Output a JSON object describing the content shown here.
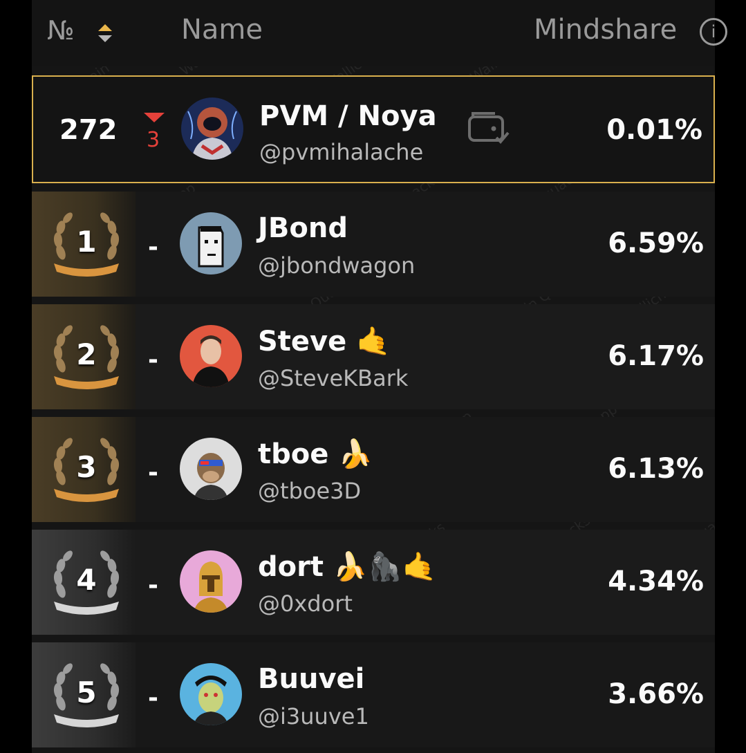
{
  "header": {
    "rank_label": "№",
    "name_label": "Name",
    "mindshare_label": "Mindshare",
    "info_glyph": "i",
    "sort_icon": "sort-updown-icon"
  },
  "watermark": [
    "Wallichain Quacks",
    "quacks.app"
  ],
  "self_row": {
    "rank": "272",
    "change": "3",
    "change_direction": "down",
    "name": "PVM / Noya",
    "handle": "@pvmihalache",
    "badge_icon": "wallet-verified-icon",
    "mindshare": "0.01%",
    "highlight_color": "#d9b04e"
  },
  "rows": [
    {
      "rank": "1",
      "change": "-",
      "name": "JBond",
      "handle": "@jbondwagon",
      "mindshare": "6.59%",
      "tier": "gold"
    },
    {
      "rank": "2",
      "change": "-",
      "name": "Steve 🤙",
      "handle": "@SteveKBark",
      "mindshare": "6.17%",
      "tier": "gold"
    },
    {
      "rank": "3",
      "change": "-",
      "name": "tboe 🍌",
      "handle": "@tboe3D",
      "mindshare": "6.13%",
      "tier": "gold"
    },
    {
      "rank": "4",
      "change": "-",
      "name": "dort 🍌🦍🤙",
      "handle": "@0xdort",
      "mindshare": "4.34%",
      "tier": "silver"
    },
    {
      "rank": "5",
      "change": "-",
      "name": "Buuvei",
      "handle": "@i3uuve1",
      "mindshare": "3.66%",
      "tier": "silver"
    }
  ]
}
